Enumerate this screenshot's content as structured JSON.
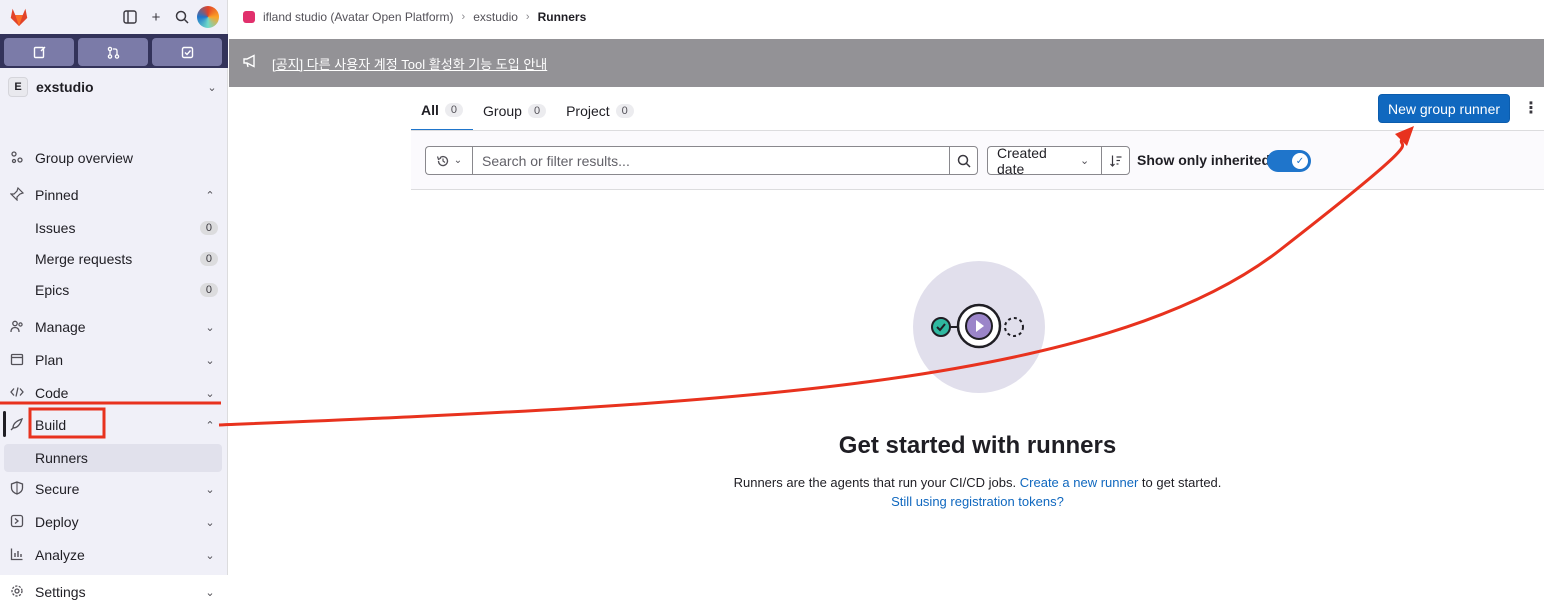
{
  "sidebar": {
    "project_badge": "E",
    "project_name": "exstudio",
    "items": [
      {
        "label": "Group overview"
      },
      {
        "label": "Pinned"
      },
      {
        "label": "Issues",
        "count": "0"
      },
      {
        "label": "Merge requests",
        "count": "0"
      },
      {
        "label": "Epics",
        "count": "0"
      },
      {
        "label": "Manage"
      },
      {
        "label": "Plan"
      },
      {
        "label": "Code"
      },
      {
        "label": "Build"
      },
      {
        "label": "Runners"
      },
      {
        "label": "Secure"
      },
      {
        "label": "Deploy"
      },
      {
        "label": "Analyze"
      },
      {
        "label": "Settings"
      }
    ]
  },
  "breadcrumb": {
    "items": [
      "ifland studio (Avatar Open Platform)",
      "exstudio",
      "Runners"
    ]
  },
  "banner": {
    "text": "[공지] 다른 사용자 계정 Tool 활성화 기능 도입 안내"
  },
  "tabs": [
    {
      "label": "All",
      "count": "0"
    },
    {
      "label": "Group",
      "count": "0"
    },
    {
      "label": "Project",
      "count": "0"
    }
  ],
  "actions": {
    "new_runner": "New group runner"
  },
  "filter": {
    "search_placeholder": "Search or filter results...",
    "sort_label": "Created date",
    "inherit_label": "Show only inherited",
    "inherit_on": true
  },
  "empty_state": {
    "title": "Get started with runners",
    "desc_before": "Runners are the agents that run your CI/CD jobs.",
    "desc_link": "Create a new runner",
    "desc_after": "to get started.",
    "secondary_link": "Still using registration tokens?"
  },
  "colors": {
    "accent": "#1068bf",
    "banner": "#939296",
    "annotation": "#e8321e"
  }
}
